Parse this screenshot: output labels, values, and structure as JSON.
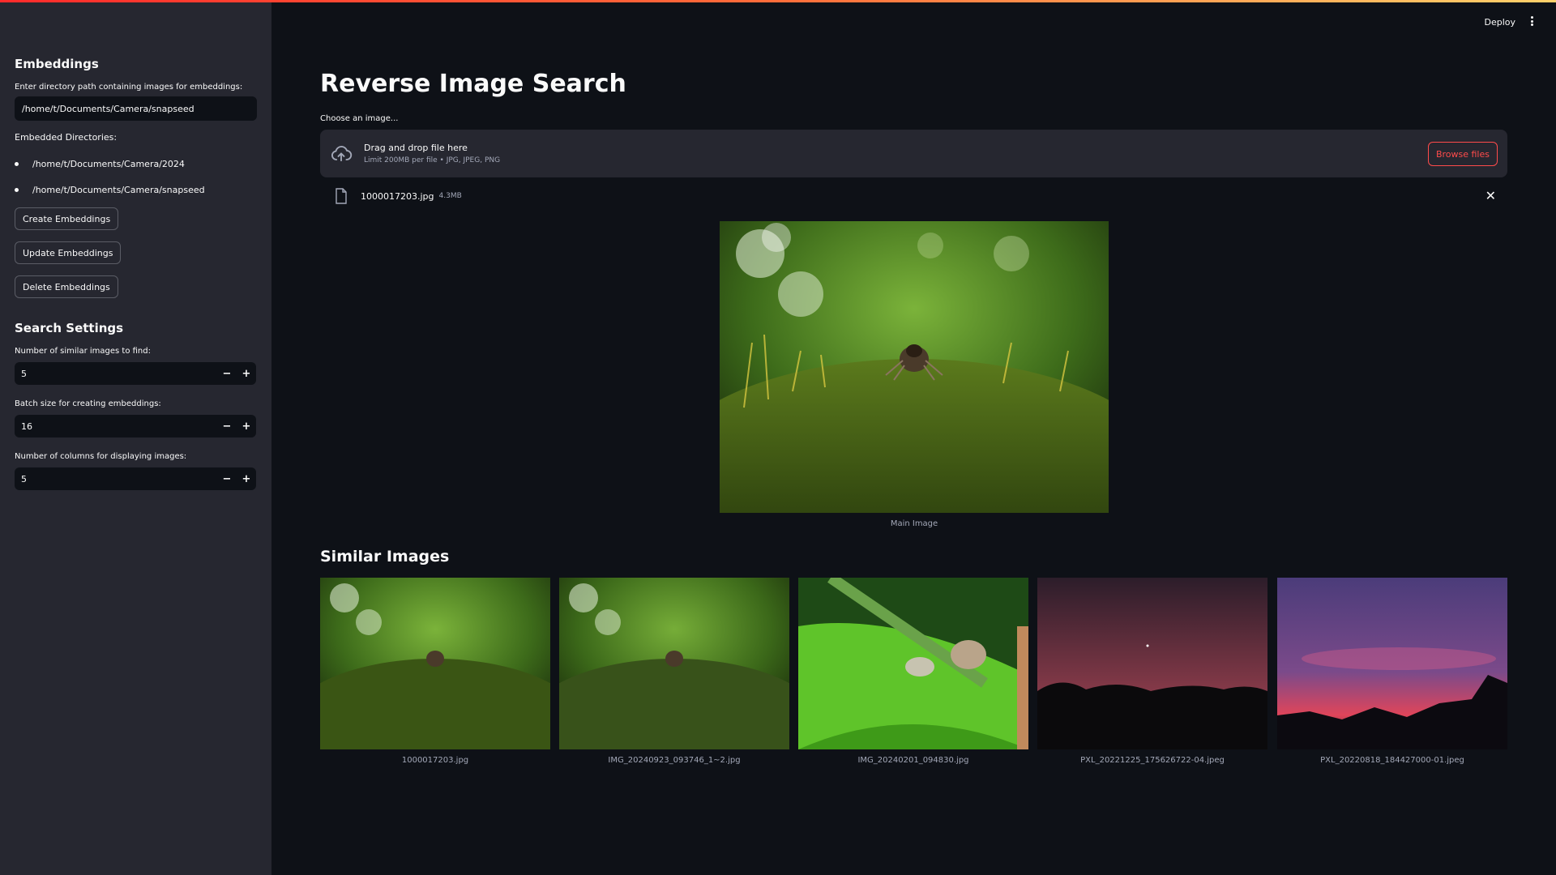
{
  "sidebar": {
    "embeddings_heading": "Embeddings",
    "dir_input_label": "Enter directory path containing images for embeddings:",
    "dir_input_value": "/home/t/Documents/Camera/snapseed",
    "embedded_dirs_label": "Embedded Directories:",
    "embedded_dirs": [
      "/home/t/Documents/Camera/2024",
      "/home/t/Documents/Camera/snapseed"
    ],
    "create_btn": "Create Embeddings",
    "update_btn": "Update Embeddings",
    "delete_btn": "Delete Embeddings",
    "search_settings_heading": "Search Settings",
    "num_similar_label": "Number of similar images to find:",
    "num_similar_value": "5",
    "batch_size_label": "Batch size for creating embeddings:",
    "batch_size_value": "16",
    "num_columns_label": "Number of columns for displaying images:",
    "num_columns_value": "5",
    "minus": "−",
    "plus": "+"
  },
  "header": {
    "deploy_label": "Deploy"
  },
  "main": {
    "title": "Reverse Image Search",
    "uploader_label": "Choose an image...",
    "dropzone_title": "Drag and drop file here",
    "dropzone_sub": "Limit 200MB per file • JPG, JPEG, PNG",
    "browse_btn": "Browse files",
    "file_name": "1000017203.jpg",
    "file_size": "4.3MB",
    "close_glyph": "✕",
    "main_caption": "Main Image",
    "similar_title": "Similar Images",
    "similar": [
      {
        "caption": "1000017203.jpg",
        "kind": "moss"
      },
      {
        "caption": "IMG_20240923_093746_1~2.jpg",
        "kind": "moss"
      },
      {
        "caption": "IMG_20240201_094830.jpg",
        "kind": "leaf"
      },
      {
        "caption": "PXL_20221225_175626722-04.jpeg",
        "kind": "dusk"
      },
      {
        "caption": "PXL_20220818_184427000-01.jpeg",
        "kind": "sunset"
      }
    ]
  },
  "colors": {
    "background": "#0e1117",
    "sidebar": "#262730",
    "accent": "#ff4b4b"
  },
  "icons": {
    "upload": "cloud-upload-icon",
    "file": "file-icon",
    "close": "close-icon",
    "menu": "kebab-menu-icon"
  }
}
